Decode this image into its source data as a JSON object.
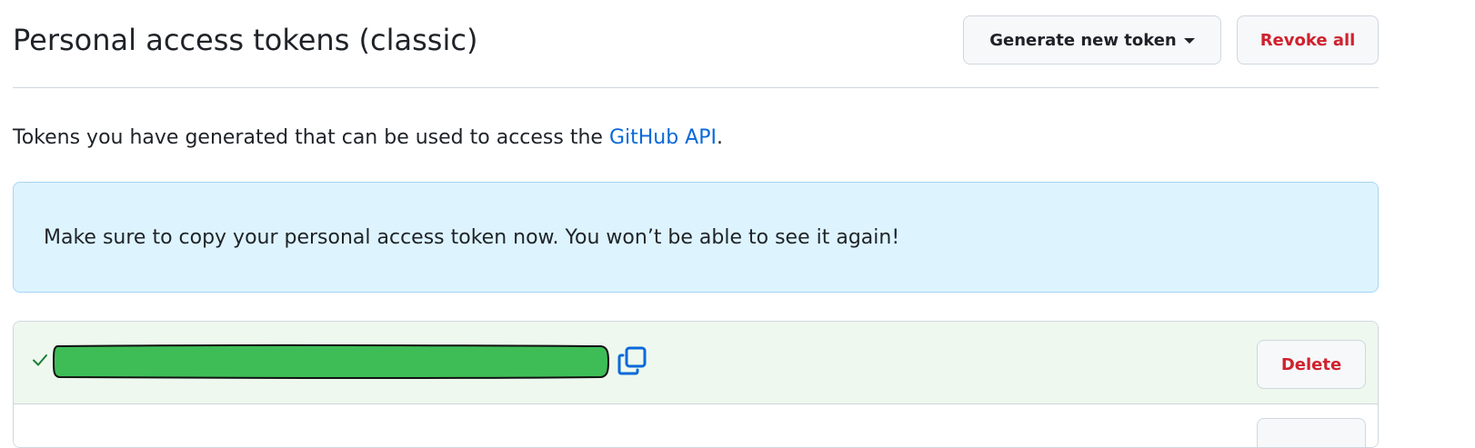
{
  "header": {
    "title": "Personal access tokens (classic)",
    "generate_button_label": "Generate new token",
    "revoke_button_label": "Revoke all"
  },
  "description": {
    "text_before_link": "Tokens you have generated that can be used to access the ",
    "link_text": "GitHub API",
    "text_after_link": "."
  },
  "flash": {
    "message": "Make sure to copy your personal access token now. You won’t be able to see it again!"
  },
  "tokens": [
    {
      "status_icon": "check-icon",
      "value_redacted": true,
      "copy_icon": "copy-icon",
      "delete_label": "Delete"
    }
  ],
  "colors": {
    "accent_link": "#0969da",
    "danger": "#cf222e",
    "flash_background": "#ddf4ff",
    "success_row_background": "#eef8ee",
    "redaction_fill": "#3ebd57",
    "success_icon": "#1a7f37"
  }
}
